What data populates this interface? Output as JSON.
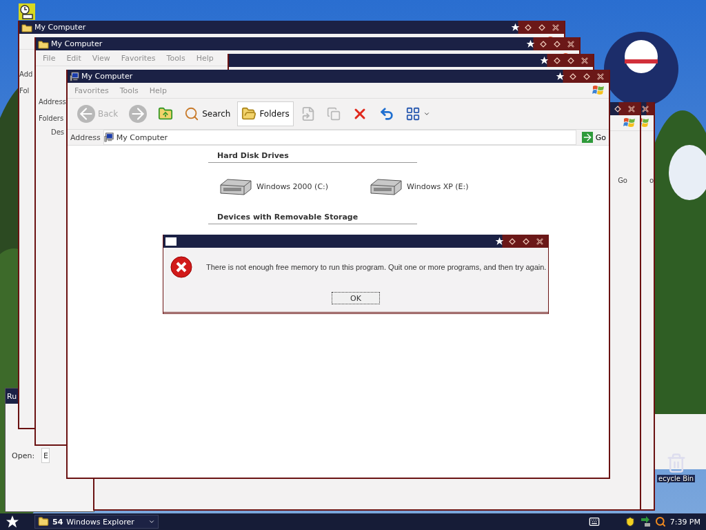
{
  "back_windows": [
    {
      "kind": "window",
      "title": "My Computer",
      "address_label": "Add",
      "folders_label": "Fol"
    },
    {
      "kind": "window",
      "title": "My Computer",
      "menu": [
        "File",
        "Edit",
        "View",
        "Favorites",
        "Tools",
        "Help"
      ],
      "address_label": "Address",
      "folders_label": "Folders",
      "tree_item": "Des"
    },
    {
      "kind": "window"
    },
    {
      "kind": "window",
      "go_label": "Go"
    },
    {
      "kind": "window",
      "go_label": "o"
    }
  ],
  "window": {
    "title": "My Computer",
    "menu": [
      "Favorites",
      "Tools",
      "Help"
    ],
    "toolbar": [
      {
        "kind": "back",
        "label": "Back",
        "disabled": true,
        "selected": false
      },
      {
        "kind": "forward",
        "disabled": true,
        "selected": false
      },
      {
        "kind": "up",
        "disabled": false,
        "selected": false
      },
      {
        "kind": "search",
        "label": "Search",
        "disabled": false,
        "selected": false
      },
      {
        "kind": "folders",
        "label": "Folders",
        "disabled": false,
        "selected": true
      },
      {
        "kind": "move",
        "disabled": true,
        "selected": false
      },
      {
        "kind": "copy",
        "disabled": true,
        "selected": false
      },
      {
        "kind": "delete",
        "disabled": false,
        "selected": false
      },
      {
        "kind": "undo",
        "disabled": false,
        "selected": false
      },
      {
        "kind": "views",
        "disabled": false,
        "selected": false
      }
    ],
    "address": {
      "label": "Address",
      "value": "My Computer",
      "go": "Go"
    },
    "sections": [
      {
        "title": "Hard Disk Drives",
        "items": [
          {
            "label": "Windows 2000 (C:)"
          },
          {
            "label": "Windows XP (E:)"
          }
        ]
      },
      {
        "title": "Devices with Removable Storage"
      }
    ]
  },
  "dialog": {
    "message": "There is not enough free memory to run this program. Quit one or more programs, and then try again.",
    "button": "OK"
  },
  "run_dialog": {
    "title": "Ru",
    "open_label": "Open:",
    "value": "E"
  },
  "desktop_icons": [
    {
      "label": "ecycle Bin"
    }
  ],
  "taskbar": {
    "task": {
      "count": "54",
      "label": "Windows Explorer"
    },
    "clock": "7:39 PM"
  }
}
